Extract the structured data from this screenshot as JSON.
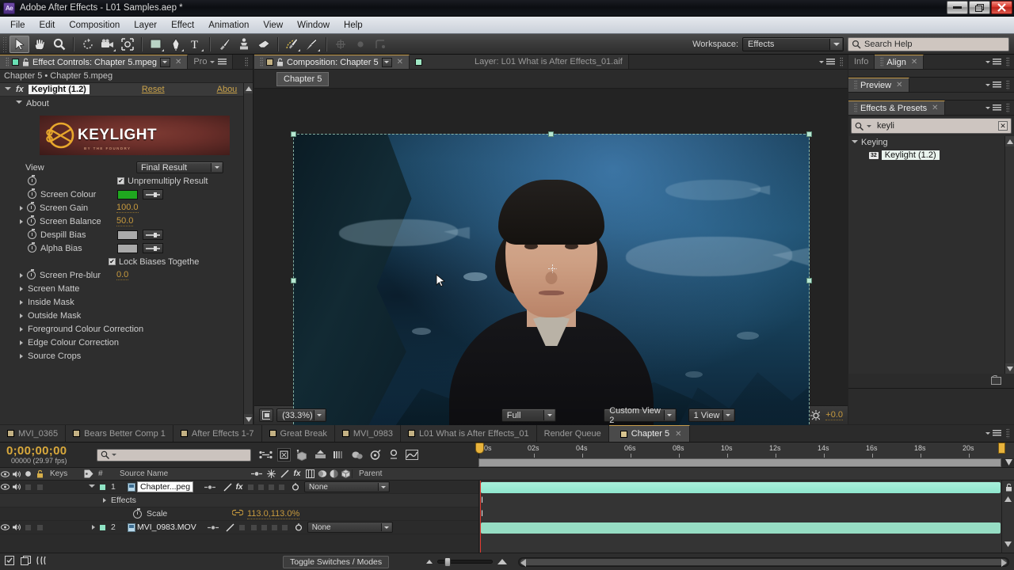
{
  "titlebar": {
    "logo": "Ae",
    "title": "Adobe After Effects - L01 Samples.aep *",
    "minimize": "–",
    "maximize": "❐",
    "close": "✕"
  },
  "menu": {
    "items": [
      "File",
      "Edit",
      "Composition",
      "Layer",
      "Effect",
      "Animation",
      "View",
      "Window",
      "Help"
    ]
  },
  "toolbar": {
    "tools": [
      {
        "name": "selection-tool",
        "active": true
      },
      {
        "name": "hand-tool",
        "active": false
      },
      {
        "name": "zoom-tool",
        "active": false
      },
      {
        "name": "rotation-tool",
        "active": false
      },
      {
        "name": "camera-tool",
        "active": false
      },
      {
        "name": "pan-behind-tool",
        "active": false
      },
      {
        "name": "shape-tool",
        "active": false
      },
      {
        "name": "pen-tool",
        "active": false
      },
      {
        "name": "type-tool",
        "active": false
      },
      {
        "name": "brush-tool",
        "active": false
      },
      {
        "name": "clone-stamp-tool",
        "active": false
      },
      {
        "name": "eraser-tool",
        "active": false
      },
      {
        "name": "roto-brush-tool",
        "active": false
      },
      {
        "name": "puppet-pin-tool",
        "active": false
      }
    ],
    "workspace_label": "Workspace:",
    "workspace_value": "Effects",
    "search_help_placeholder": "Search Help"
  },
  "effect_controls": {
    "tab_title": "Effect Controls: Chapter 5.mpeg",
    "second_tab": "Pro",
    "breadcrumb": "Chapter 5 • Chapter 5.mpeg",
    "effect_name": "Keylight (1.2)",
    "reset_label": "Reset",
    "about_link": "Abou",
    "about_section": "About",
    "logo_text": "KEYLIGHT",
    "logo_subtext": "BY THE FOUNDRY",
    "properties": [
      {
        "label": "View",
        "type": "dropdown",
        "value": "Final Result"
      },
      {
        "label": "",
        "type": "checkbox",
        "value": "Unpremultiply Result",
        "checked": true
      },
      {
        "label": "Screen Colour",
        "type": "color",
        "value": "#1fa81f"
      },
      {
        "label": "Screen Gain",
        "type": "number",
        "value": "100.0"
      },
      {
        "label": "Screen Balance",
        "type": "number",
        "value": "50.0"
      },
      {
        "label": "Despill Bias",
        "type": "color",
        "value": "#aaaaaa"
      },
      {
        "label": "Alpha Bias",
        "type": "color",
        "value": "#aaaaaa"
      },
      {
        "label": "",
        "type": "checkbox",
        "value": "Lock Biases Togethe",
        "checked": true
      },
      {
        "label": "Screen Pre-blur",
        "type": "number",
        "value": "0.0"
      }
    ],
    "groups": [
      "Screen Matte",
      "Inside Mask",
      "Outside Mask",
      "Foreground Colour Correction",
      "Edge Colour Correction",
      "Source Crops"
    ]
  },
  "composition": {
    "tab_title": "Composition: Chapter 5",
    "layer_tab_title": "Layer: L01 What is After Effects_01.aif",
    "comp_chip": "Chapter 5",
    "toolbar": {
      "zoom": "(33.3%)",
      "timecode": "0;00;00;00",
      "quality": "Full",
      "view_preset": "Custom View 2",
      "view_count": "1 View",
      "exposure": "+0.0"
    }
  },
  "right_panels": {
    "info_tab": "Info",
    "align_tab": "Align",
    "preview_tab": "Preview",
    "effects_presets_tab": "Effects & Presets",
    "search_value": "keyli",
    "tree": [
      {
        "label": "Keying",
        "type": "category"
      },
      {
        "label": "Keylight (1.2)",
        "type": "effect",
        "badge": "32",
        "selected": true
      }
    ]
  },
  "timeline_tabs": [
    {
      "label": "MVI_0365",
      "active": false
    },
    {
      "label": "Bears Better Comp 1",
      "active": false
    },
    {
      "label": "After Effects 1-7",
      "active": false
    },
    {
      "label": "Great Break",
      "active": false
    },
    {
      "label": "MVI_0983",
      "active": false
    },
    {
      "label": "L01 What is After Effects_01",
      "active": false
    },
    {
      "label": "Render Queue",
      "active": false,
      "no_swatch": true
    },
    {
      "label": "Chapter 5",
      "active": true
    }
  ],
  "timeline": {
    "current_time": "0;00;00;00",
    "frame_info": "00000 (29.97 fps)",
    "search_placeholder": "",
    "columns": [
      "Keys",
      "#",
      "Source Name",
      "Parent"
    ],
    "layers": [
      {
        "index": "1",
        "name": "Chapter...peg",
        "parent": "None",
        "has_fx": true,
        "expanded": true,
        "children": [
          {
            "label": "Effects",
            "type": "group"
          },
          {
            "label": "Scale",
            "type": "property",
            "value": "113.0,113.0%",
            "linked": true
          }
        ]
      },
      {
        "index": "2",
        "name": "MVI_0983.MOV",
        "parent": "None",
        "has_fx": false,
        "expanded": false,
        "children": []
      }
    ],
    "ruler_ticks": [
      "0s",
      "02s",
      "04s",
      "06s",
      "08s",
      "10s",
      "12s",
      "14s",
      "16s",
      "18s",
      "20s"
    ],
    "toggle_switches_label": "Toggle Switches / Modes"
  },
  "colors": {
    "accent_gold": "#c79a3e",
    "track_green": "#97e7cd",
    "cti_red": "#e03a30",
    "screen_colour": "#1fa81f",
    "panel_bg": "#2e2e2e"
  }
}
